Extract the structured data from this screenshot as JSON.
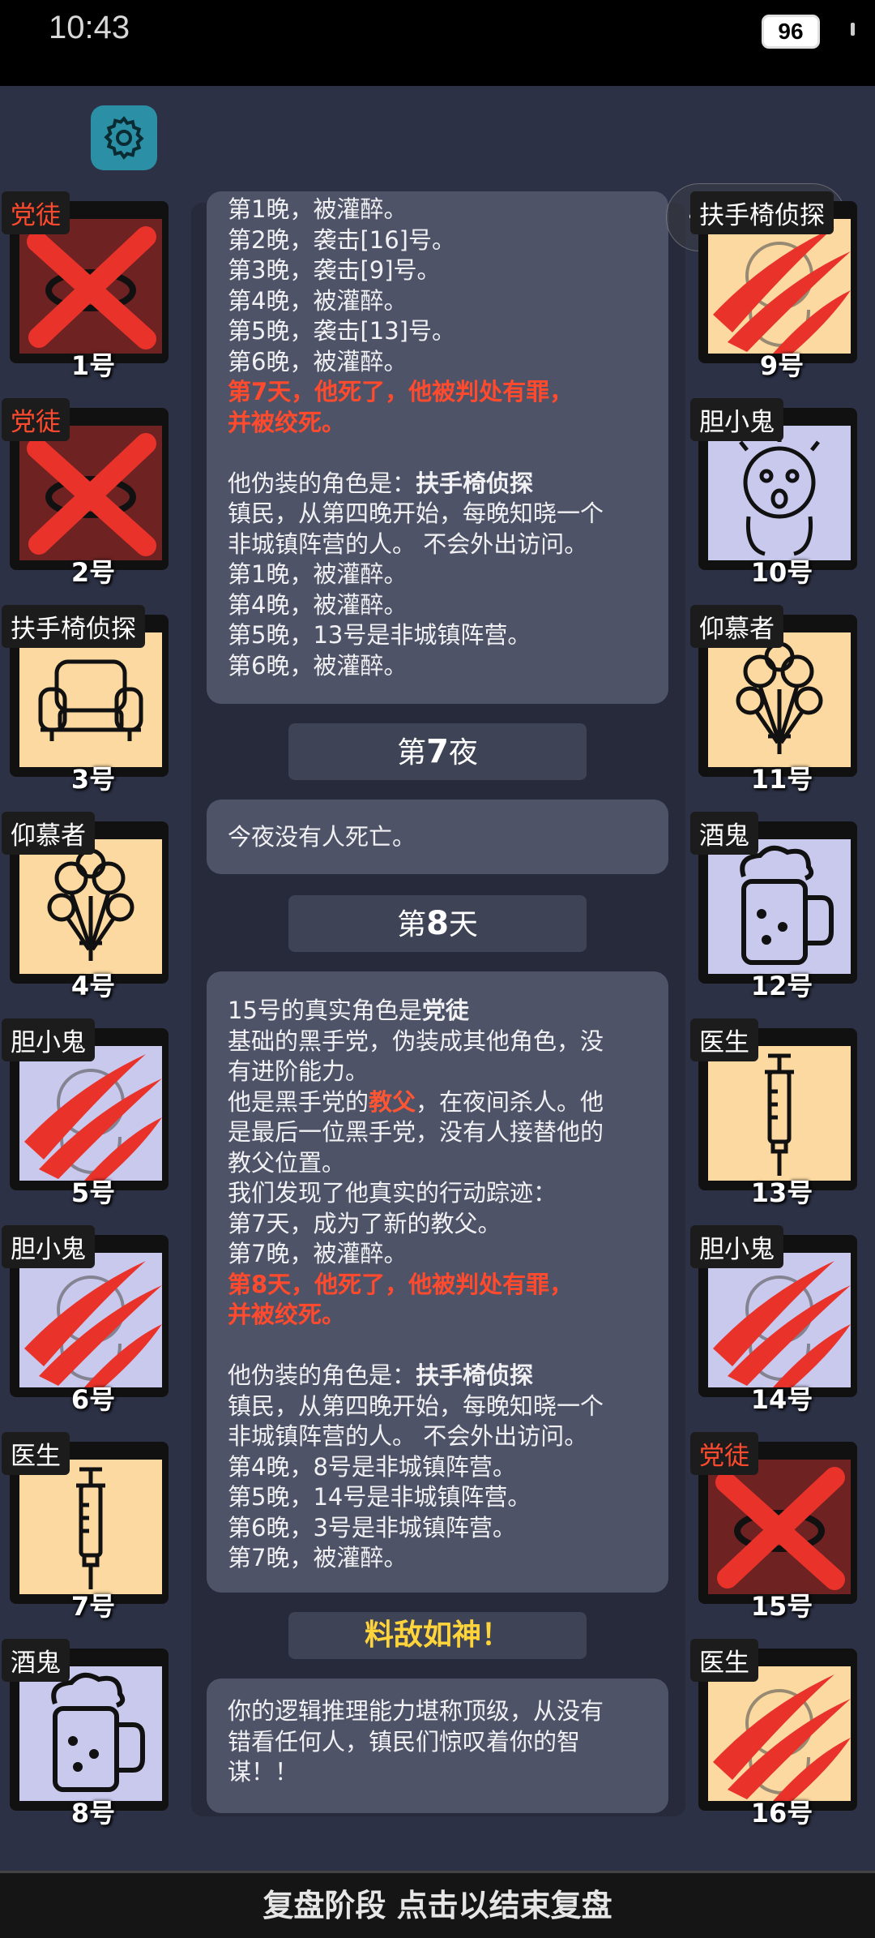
{
  "status": {
    "time": "10:43",
    "battery": "96"
  },
  "center": {
    "card1_lines": [
      "第1晚，被灌醉。",
      "第2晚，袭击[16]号。",
      "第3晚，袭击[9]号。",
      "第4晚，被灌醉。",
      "第5晚，袭击[13]号。",
      "第6晚，被灌醉。"
    ],
    "card1_death": [
      "第7天，他死了，他被判处有罪，",
      "并被绞死。"
    ],
    "card1_disguise_prefix": "他伪装的角色是：",
    "card1_disguise_role": "扶手椅侦探",
    "card1_lines2": [
      "镇民，从第四晚开始，每晚知晓一个",
      "非城镇阵营的人。 不会外出访问。",
      "第1晚，被灌醉。",
      "第4晚，被灌醉。",
      "第5晚，13号是非城镇阵营。",
      "第6晚，被灌醉。"
    ],
    "night7_prefix": "第",
    "night7_num": "7",
    "night7_suffix": "夜",
    "card2": "今夜没有人死亡。",
    "day8_prefix": "第",
    "day8_num": "8",
    "day8_suffix": "天",
    "card3_role_prefix": "15号的真实角色是",
    "card3_role": "党徒",
    "card3_desc": [
      "基础的黑手党，伪装成其他角色，没",
      "有进阶能力。"
    ],
    "card3_gf_prefix": "他是黑手党的",
    "card3_gf_role": "教父",
    "card3_gf_suffix": "，在夜间杀人。他",
    "card3_gf_lines": [
      "是最后一位黑手党，没有人接替他的",
      "教父位置。",
      "我们发现了他真实的行动踪迹：",
      "第7天，成为了新的教父。",
      "第7晚，被灌醉。"
    ],
    "card3_death": [
      "第8天，他死了，他被判处有罪，",
      "并被绞死。"
    ],
    "card3_disguise_prefix": "他伪装的角色是：",
    "card3_disguise_role": "扶手椅侦探",
    "card3_lines2": [
      "镇民，从第四晚开始，每晚知晓一个",
      "非城镇阵营的人。 不会外出访问。",
      "第4晚，8号是非城镇阵营。",
      "第5晚，14号是非城镇阵营。",
      "第6晚，3号是非城镇阵营。",
      "第7晚，被灌醉。"
    ],
    "result_title": "料敌如神！",
    "result_text": [
      "你的逻辑推理能力堪称顶级，从没有",
      "错看任何人，镇民们惊叹着你的智",
      "谋！！"
    ]
  },
  "left_players": [
    {
      "role": "党徒",
      "num": "1号",
      "icon": "cross-icon",
      "bg": "dark"
    },
    {
      "role": "党徒",
      "num": "2号",
      "icon": "cross-icon",
      "bg": "dark"
    },
    {
      "role": "扶手椅侦探",
      "num": "3号",
      "icon": "armchair-icon",
      "bg": "beige"
    },
    {
      "role": "仰慕者",
      "num": "4号",
      "icon": "roses-icon",
      "bg": "beige"
    },
    {
      "role": "胆小鬼",
      "num": "5号",
      "icon": "claw-icon",
      "bg": "lav"
    },
    {
      "role": "胆小鬼",
      "num": "6号",
      "icon": "claw-icon",
      "bg": "lav"
    },
    {
      "role": "医生",
      "num": "7号",
      "icon": "syringe-icon",
      "bg": "beige"
    },
    {
      "role": "酒鬼",
      "num": "8号",
      "icon": "beer-icon",
      "bg": "lav"
    }
  ],
  "right_players": [
    {
      "role": "扶手椅侦探",
      "num": "9号",
      "icon": "claw-icon",
      "bg": "beige"
    },
    {
      "role": "胆小鬼",
      "num": "10号",
      "icon": "scared-face-icon",
      "bg": "lav"
    },
    {
      "role": "仰慕者",
      "num": "11号",
      "icon": "roses-icon",
      "bg": "beige"
    },
    {
      "role": "酒鬼",
      "num": "12号",
      "icon": "beer-icon",
      "bg": "lav"
    },
    {
      "role": "医生",
      "num": "13号",
      "icon": "syringe-icon",
      "bg": "beige"
    },
    {
      "role": "胆小鬼",
      "num": "14号",
      "icon": "claw-icon",
      "bg": "lav"
    },
    {
      "role": "党徒",
      "num": "15号",
      "icon": "cross-icon",
      "bg": "dark"
    },
    {
      "role": "医生",
      "num": "16号",
      "icon": "claw-icon",
      "bg": "beige"
    }
  ],
  "bottom_bar": "复盘阶段 点击以结束复盘",
  "colors": {
    "accent_red": "#ff4a2e",
    "gold": "#ffd43b",
    "panel": "#4e5367"
  }
}
